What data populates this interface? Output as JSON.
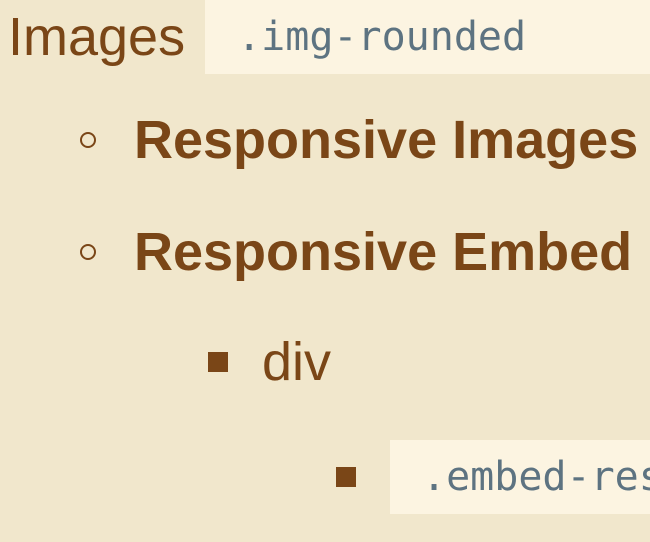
{
  "list": {
    "images": {
      "label": "Images",
      "code": ".img-rounded"
    },
    "responsive_images": {
      "label": "Responsive Images"
    },
    "responsive_embed": {
      "label": "Responsive Embed"
    },
    "div_item": {
      "label": "div"
    },
    "embed_code": {
      "code": ".embed-responsive"
    }
  }
}
